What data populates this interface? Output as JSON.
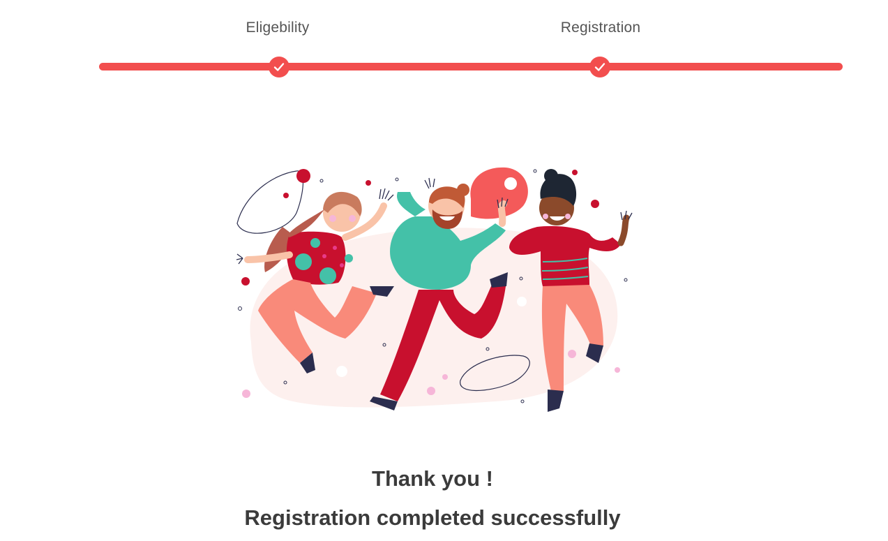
{
  "stepper": {
    "steps": [
      {
        "label": "Eligebility",
        "status": "completed"
      },
      {
        "label": "Registration",
        "status": "completed"
      }
    ],
    "accent_color": "#f24e4e",
    "check_icon": "checkmark-icon"
  },
  "illustration": {
    "name": "celebrating-people-illustration"
  },
  "message": {
    "title": "Thank you !",
    "subtitle": "Registration completed successfully",
    "text_color": "#3b3b3b"
  }
}
